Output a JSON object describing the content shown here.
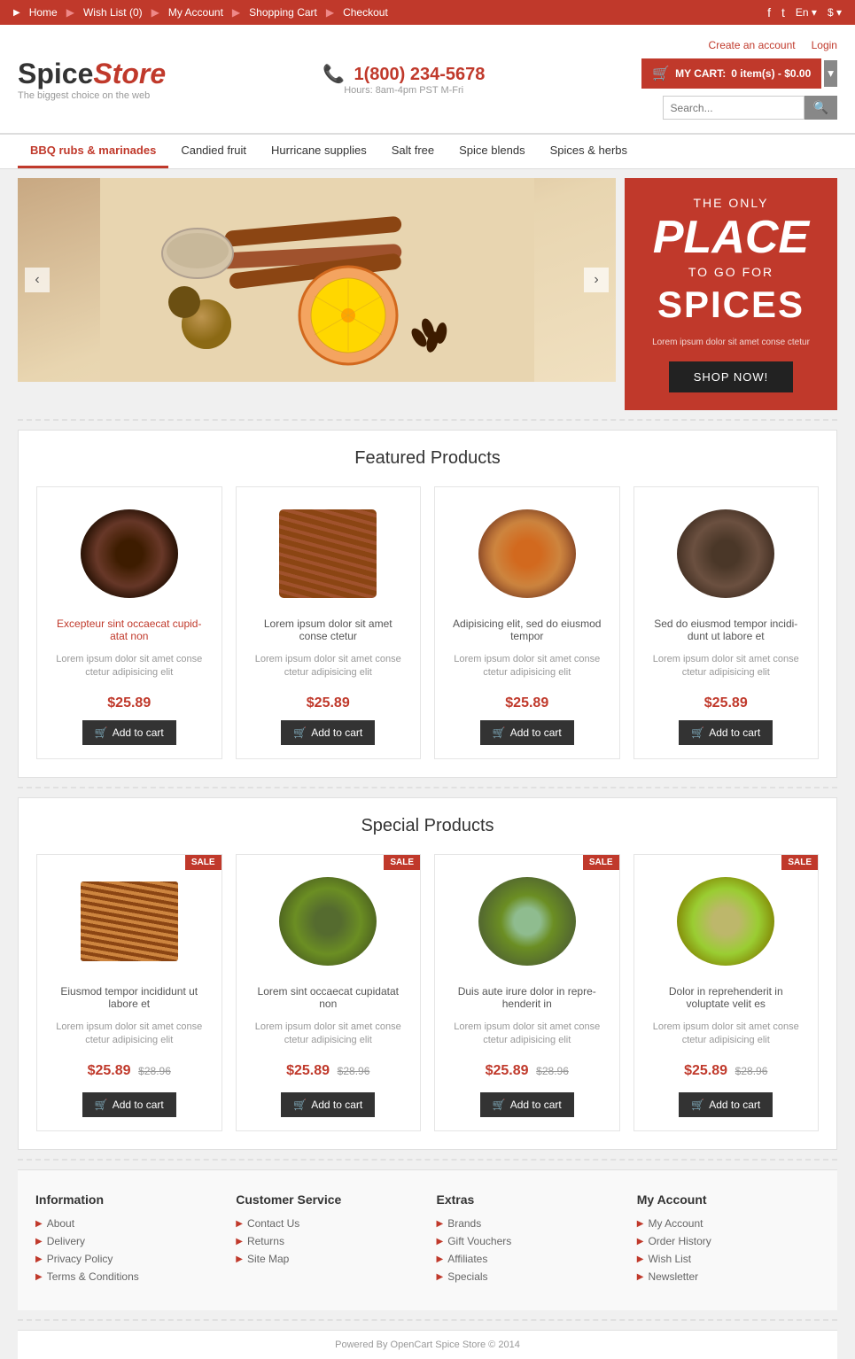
{
  "topbar": {
    "links": [
      {
        "label": "Home",
        "href": "#"
      },
      {
        "label": "Wish List (0)",
        "href": "#"
      },
      {
        "label": "My Account",
        "href": "#"
      },
      {
        "label": "Shopping Cart",
        "href": "#"
      },
      {
        "label": "Checkout",
        "href": "#"
      }
    ],
    "lang": "En",
    "currency": "$",
    "social": [
      "f",
      "t"
    ]
  },
  "header": {
    "logo_spice": "Spice",
    "logo_store": "Store",
    "logo_sub": "The biggest choice on the web",
    "create_account": "Create an account",
    "login": "Login",
    "phone": "1(800) 234-5678",
    "hours": "Hours: 8am-4pm PST M-Fri",
    "cart_label": "MY CART:",
    "cart_items": "0 item(s) - $0.00",
    "search_placeholder": "Search..."
  },
  "nav": {
    "items": [
      {
        "label": "BBQ rubs & marinades",
        "active": true
      },
      {
        "label": "Candied fruit",
        "active": false
      },
      {
        "label": "Hurricane supplies",
        "active": false
      },
      {
        "label": "Salt free",
        "active": false
      },
      {
        "label": "Spice blends",
        "active": false
      },
      {
        "label": "Spices & herbs",
        "active": false
      }
    ]
  },
  "hero": {
    "banner_the_only": "THE ONLY",
    "banner_place": "PLACE",
    "banner_to_go_for": "TO GO FOR",
    "banner_spices": "SPICES",
    "banner_desc": "Lorem ipsum dolor sit amet conse ctetur",
    "shop_now": "SHOP NOW!"
  },
  "featured": {
    "title": "Featured Products",
    "products": [
      {
        "name": "Excepteur sint occaecat cupid-atat non",
        "desc": "Lorem ipsum dolor sit amet conse ctetur adipisicing elit",
        "price": "$25.89",
        "btn": "Add to cart",
        "name_color": "red",
        "spice_type": "cloves"
      },
      {
        "name": "Lorem ipsum dolor sit amet conse ctetur",
        "desc": "Lorem ipsum dolor sit amet conse ctetur adipisicing elit",
        "price": "$25.89",
        "btn": "Add to cart",
        "name_color": "dark",
        "spice_type": "sticks"
      },
      {
        "name": "Adipisicing elit, sed do eiusmod tempor",
        "desc": "Lorem ipsum dolor sit amet conse ctetur adipisicing elit",
        "price": "$25.89",
        "btn": "Add to cart",
        "name_color": "dark",
        "spice_type": "powder"
      },
      {
        "name": "Sed do eiusmod tempor incidi-dunt ut labore et",
        "desc": "Lorem ipsum dolor sit amet conse ctetur adipisicing elit",
        "price": "$25.89",
        "btn": "Add to cart",
        "name_color": "dark",
        "spice_type": "mixed"
      }
    ]
  },
  "special": {
    "title": "Special Products",
    "products": [
      {
        "name": "Eiusmod tempor incididunt ut labore et",
        "desc": "Lorem ipsum dolor sit amet conse ctetur adipisicing elit",
        "price": "$25.89",
        "old_price": "$28.96",
        "btn": "Add to cart",
        "sale": "SALE",
        "spice_type": "cinnamon"
      },
      {
        "name": "Lorem sint occaecat cupidatat non",
        "desc": "Lorem ipsum dolor sit amet conse ctetur adipisicing elit",
        "price": "$25.89",
        "old_price": "$28.96",
        "btn": "Add to cart",
        "sale": "SALE",
        "spice_type": "green"
      },
      {
        "name": "Duis aute irure dolor in repre-henderit in",
        "desc": "Lorem ipsum dolor sit amet conse ctetur adipisicing elit",
        "price": "$25.89",
        "old_price": "$28.96",
        "btn": "Add to cart",
        "sale": "SALE",
        "spice_type": "herb"
      },
      {
        "name": "Dolor in reprehenderit in voluptate velit es",
        "desc": "Lorem ipsum dolor sit amet conse ctetur adipisicing elit",
        "price": "$25.89",
        "old_price": "$28.96",
        "btn": "Add to cart",
        "sale": "SALE",
        "spice_type": "seeds"
      }
    ]
  },
  "footer": {
    "columns": [
      {
        "title": "Information",
        "links": [
          "About",
          "Delivery",
          "Privacy Policy",
          "Terms & Conditions"
        ]
      },
      {
        "title": "Customer Service",
        "links": [
          "Contact Us",
          "Returns",
          "Site Map"
        ]
      },
      {
        "title": "Extras",
        "links": [
          "Brands",
          "Gift Vouchers",
          "Affiliates",
          "Specials"
        ]
      },
      {
        "title": "My Account",
        "links": [
          "My Account",
          "Order History",
          "Wish List",
          "Newsletter"
        ]
      }
    ]
  },
  "bottom": {
    "text": "Powered By OpenCart Spice Store © 2014"
  }
}
